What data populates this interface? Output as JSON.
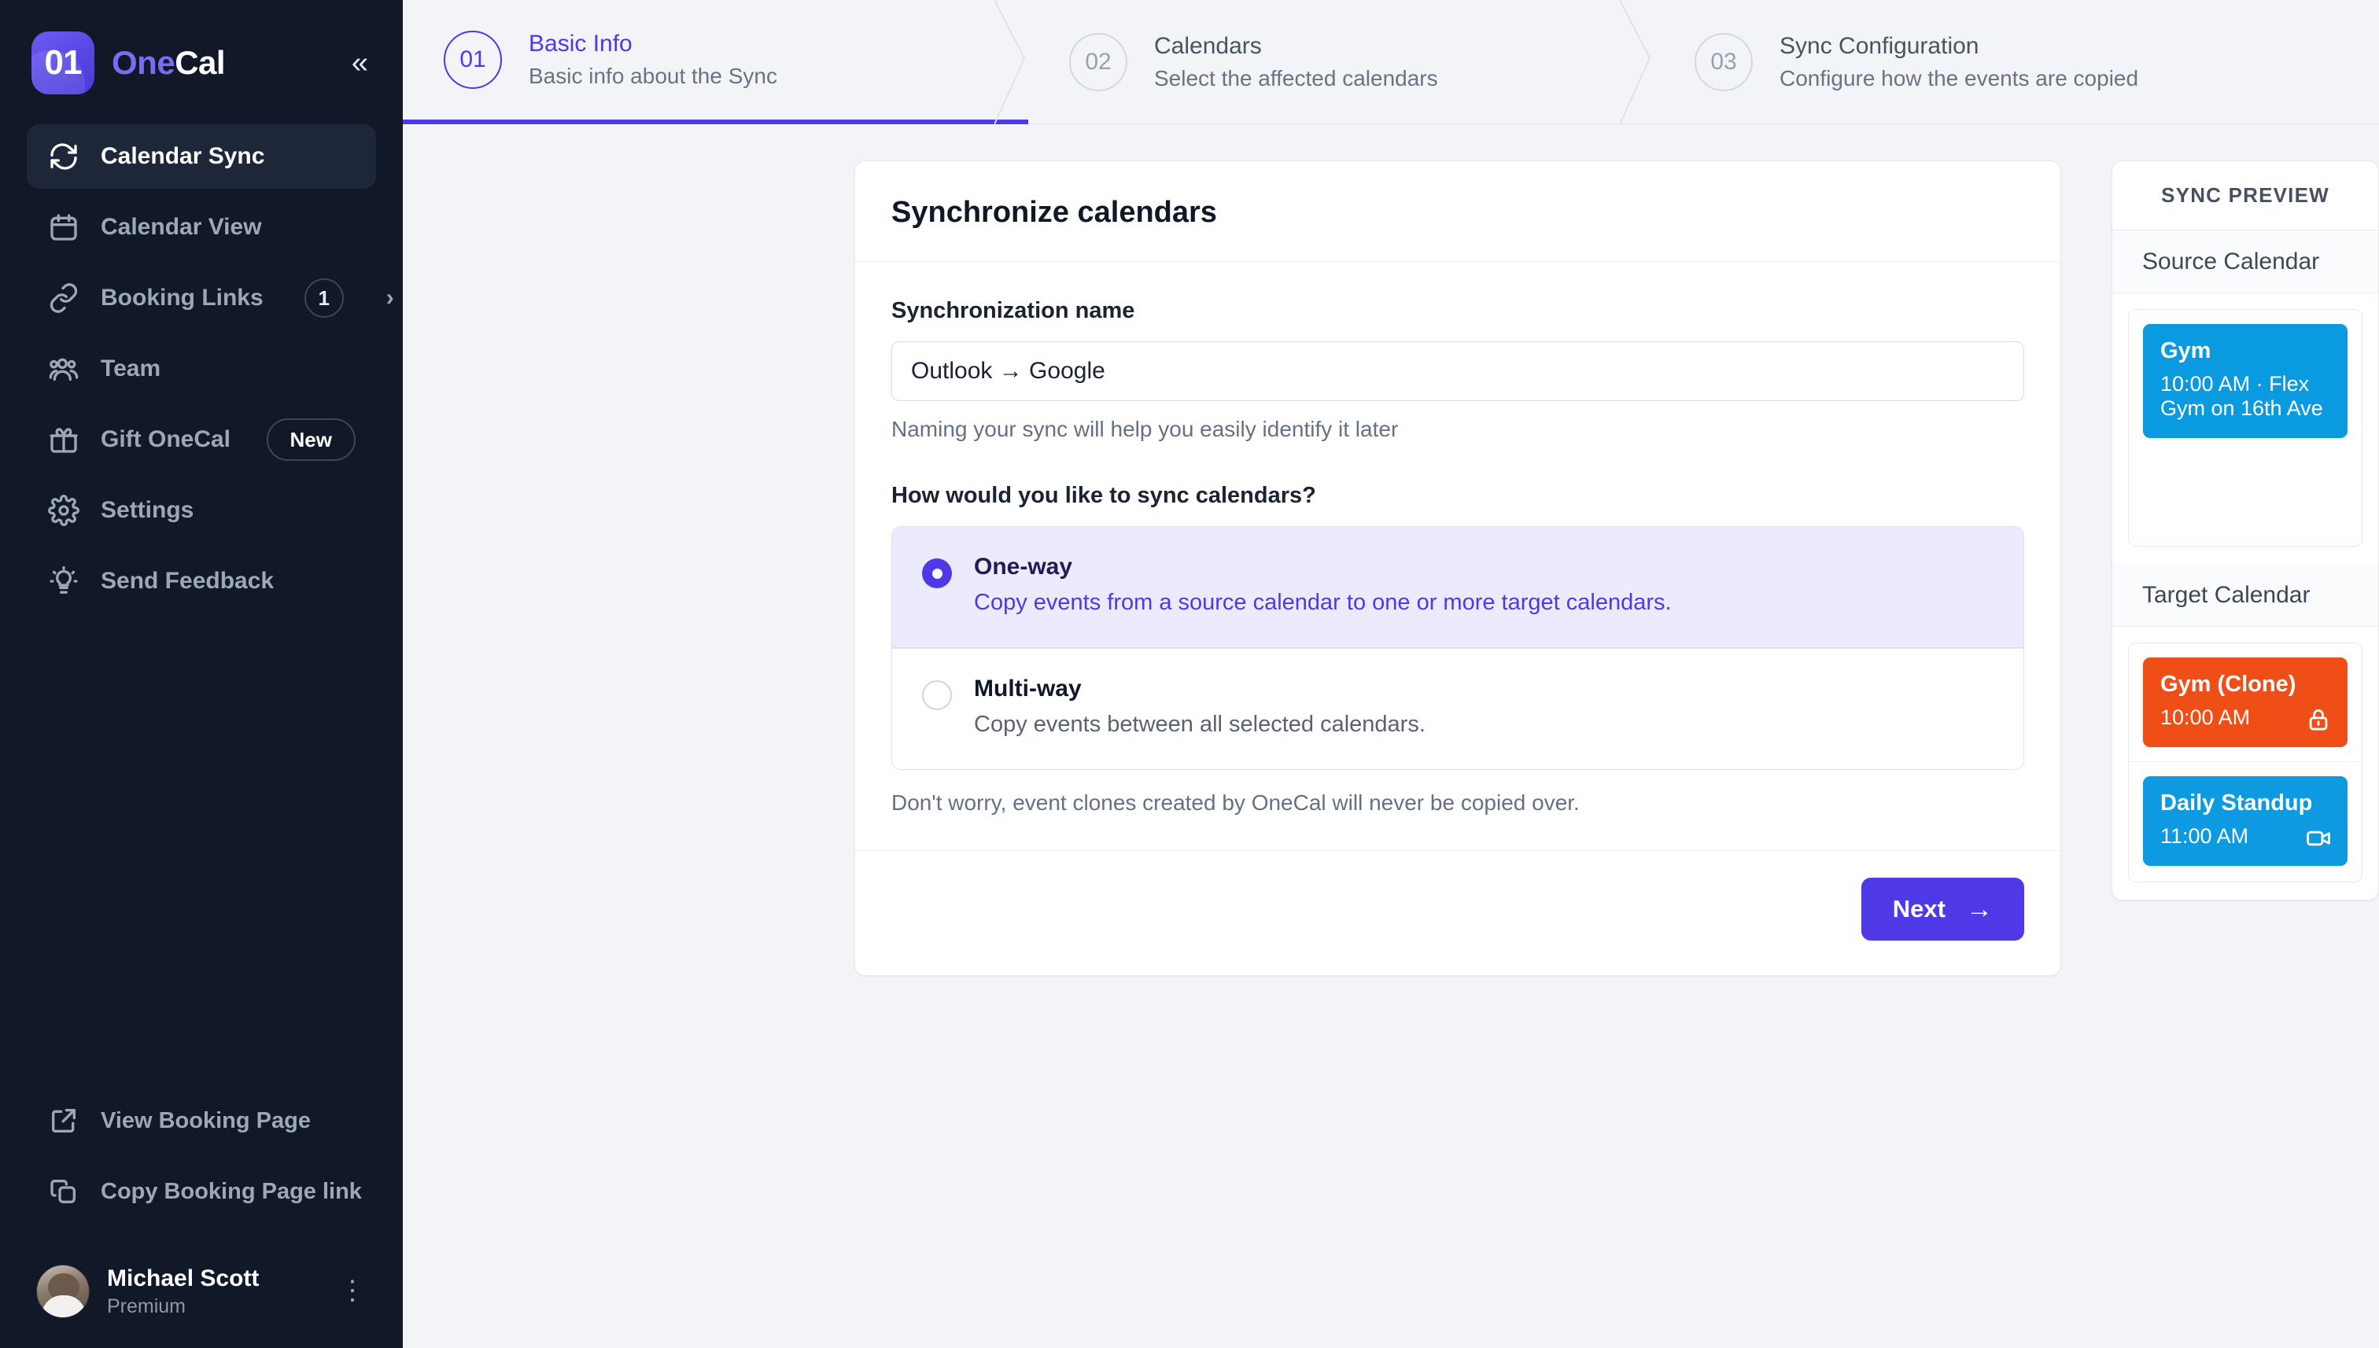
{
  "brand": {
    "logo_mark": "01",
    "name_one": "One",
    "name_cal": "Cal",
    "collapse_icon": "chevrons-left-icon"
  },
  "sidebar": {
    "items": [
      {
        "id": "calendar-sync",
        "label": "Calendar Sync",
        "icon": "sync-icon",
        "active": true
      },
      {
        "id": "calendar-view",
        "label": "Calendar View",
        "icon": "calendar-icon",
        "active": false
      },
      {
        "id": "booking-links",
        "label": "Booking Links",
        "icon": "link-icon",
        "badge": "1",
        "chevron": "chevron-right-icon",
        "active": false
      },
      {
        "id": "team",
        "label": "Team",
        "icon": "users-icon",
        "active": false
      },
      {
        "id": "gift-onecal",
        "label": "Gift OneCal",
        "icon": "gift-icon",
        "pill": "New",
        "active": false
      },
      {
        "id": "settings",
        "label": "Settings",
        "icon": "gear-icon",
        "active": false
      },
      {
        "id": "send-feedback",
        "label": "Send Feedback",
        "icon": "lightbulb-icon",
        "active": false
      }
    ],
    "bottom_items": [
      {
        "id": "view-booking-page",
        "label": "View Booking Page",
        "icon": "external-link-icon"
      },
      {
        "id": "copy-booking-page-link",
        "label": "Copy Booking Page link",
        "icon": "copy-icon"
      }
    ],
    "user": {
      "name": "Michael Scott",
      "plan": "Premium",
      "menu_icon": "kebab-menu-icon"
    }
  },
  "stepper": {
    "steps": [
      {
        "num": "01",
        "title": "Basic Info",
        "subtitle": "Basic info about the Sync",
        "active": true
      },
      {
        "num": "02",
        "title": "Calendars",
        "subtitle": "Select the affected calendars",
        "active": false
      },
      {
        "num": "03",
        "title": "Sync Configuration",
        "subtitle": "Configure how the events are copied",
        "active": false
      }
    ]
  },
  "form": {
    "title": "Synchronize calendars",
    "name_label": "Synchronization name",
    "name_value": "Outlook → Google",
    "name_placeholder": "Synchronization name",
    "name_helper": "Naming your sync will help you easily identify it later",
    "question": "How would you like to sync calendars?",
    "options": [
      {
        "id": "one-way",
        "title": "One-way",
        "desc": "Copy events from a source calendar to one or more target calendars.",
        "selected": true
      },
      {
        "id": "multi-way",
        "title": "Multi-way",
        "desc": "Copy events between all selected calendars.",
        "selected": false
      }
    ],
    "note": "Don't worry, event clones created by OneCal will never be copied over.",
    "next_label": "Next",
    "next_icon": "arrow-right-icon"
  },
  "preview": {
    "heading": "SYNC PREVIEW",
    "source_label": "Source Calendar",
    "target_label": "Target Calendar",
    "source_events": [
      {
        "title": "Gym",
        "sub": "10:00 AM · Flex Gym on 16th Ave",
        "color": "#0a9ae0",
        "icon": null
      }
    ],
    "target_events": [
      {
        "title": "Gym (Clone)",
        "sub": "10:00 AM",
        "color": "#f04e17",
        "icon": "lock-icon"
      },
      {
        "title": "Daily Standup",
        "sub": "11:00 AM",
        "color": "#0e9ae0",
        "icon": "video-icon"
      }
    ]
  },
  "colors": {
    "accent": "#4f39e6",
    "sidebar_bg": "#111827",
    "page_bg": "#f2f4f7",
    "source_event": "#0a9ae0",
    "clone_event": "#f04e17"
  }
}
